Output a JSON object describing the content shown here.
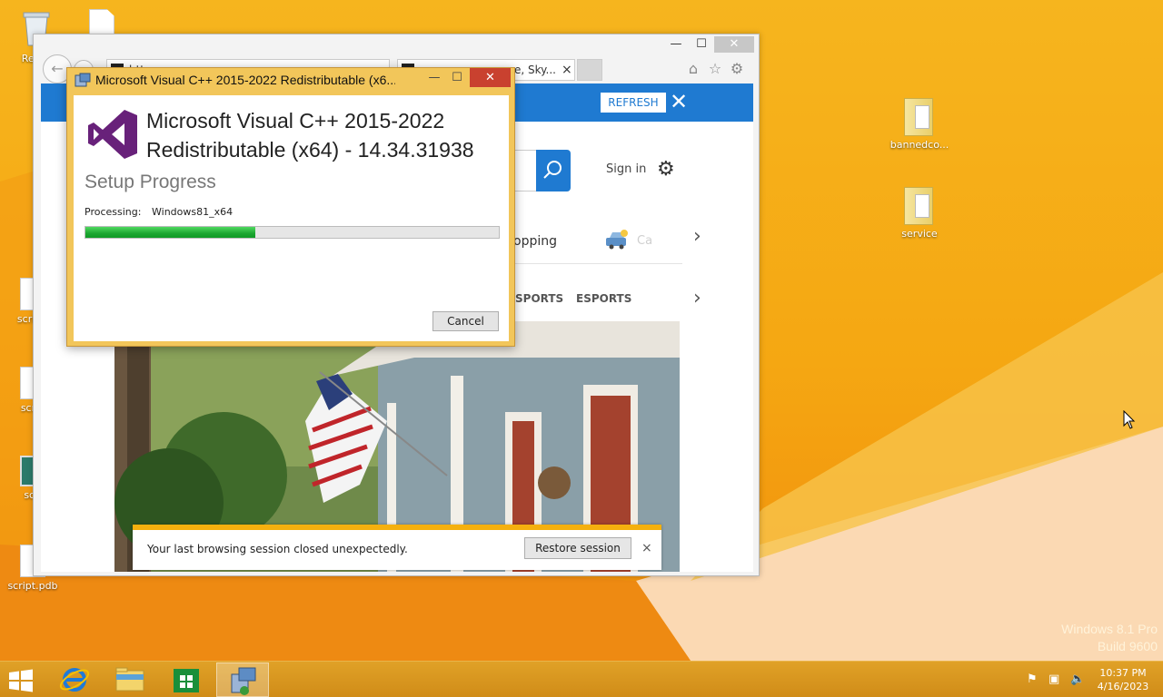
{
  "desktop": {
    "icons": [
      {
        "label": "Recycle Bin",
        "visible_label": "Recyc"
      },
      {
        "label": ""
      },
      {
        "label": "script.",
        "visible_label": "script."
      },
      {
        "label": "scrip",
        "visible_label": "scrip"
      },
      {
        "label": "scri",
        "visible_label": "scri"
      },
      {
        "label": "script.pdb",
        "visible_label": "script.pdb"
      },
      {
        "label": "bannedco...",
        "visible_label": "bannedco..."
      },
      {
        "label": "service",
        "visible_label": "service"
      }
    ],
    "watermark": {
      "line1": "Windows 8.1 Pro",
      "line2": "Build 9600"
    }
  },
  "browser": {
    "tabs": [
      {
        "label": "http..."
      },
      {
        "label": "e, Sky..."
      }
    ],
    "tab_close": "×",
    "controls": {
      "minimize": "—",
      "maximize": "☐",
      "close": "✕"
    },
    "msn": {
      "refresh_label": "REFRESH",
      "close_glyph": "✕",
      "sign_in": "Sign in",
      "shopping_label": "opping",
      "faded_label": "Ca",
      "nav_words": [
        "SPORTS",
        "ESPORTS"
      ],
      "chevron": "›"
    },
    "restore_bar": {
      "message": "Your last browsing session closed unexpectedly.",
      "button": "Restore session",
      "close": "×"
    }
  },
  "installer": {
    "window_title": "Microsoft Visual C++ 2015-2022 Redistributable (x6...",
    "controls": {
      "minimize": "—",
      "maximize": "☐",
      "close": "✕"
    },
    "product_line1": "Microsoft Visual C++ 2015-2022",
    "product_line2": "Redistributable (x64) - 14.34.31938",
    "heading": "Setup Progress",
    "processing_label": "Processing:",
    "processing_value": "Windows81_x64",
    "progress_fraction": 0.41,
    "cancel_label": "Cancel"
  },
  "taskbar": {
    "pinned": [
      {
        "name": "internet-explorer"
      },
      {
        "name": "file-explorer"
      },
      {
        "name": "store"
      },
      {
        "name": "installer",
        "active": true
      }
    ],
    "clock_time": "10:37 PM",
    "clock_date": "4/16/2023"
  },
  "colors": {
    "desktop": "#f5a712",
    "accent_blue": "#1f7ad1",
    "vs_purple": "#68217a",
    "progress_green": "#1da631",
    "dialog_frame": "#f2c65a"
  }
}
